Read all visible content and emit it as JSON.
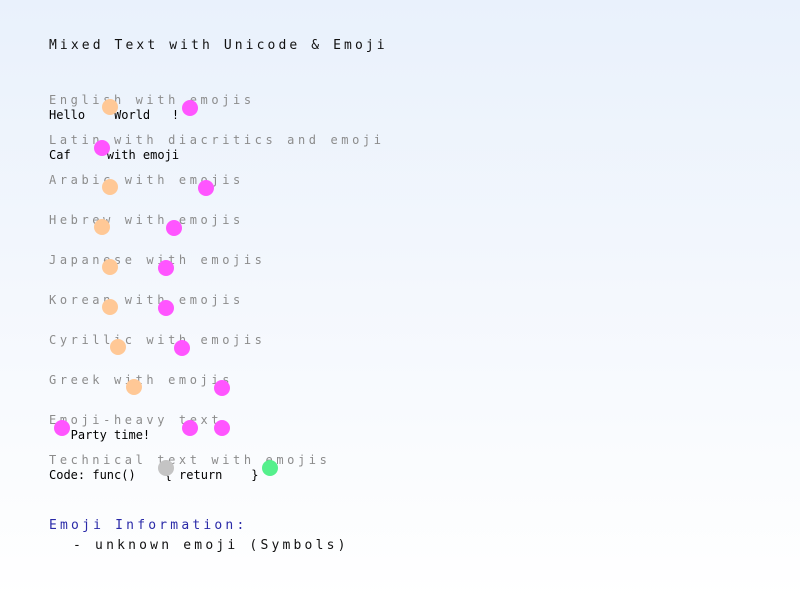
{
  "title": "Mixed Text with Unicode & Emoji",
  "sections": [
    {
      "label": "English with emojis",
      "sample": "Hello    World   !",
      "emoji_icons": [
        "face-emoji-icon",
        "party-emoji-icon"
      ]
    },
    {
      "label": "Latin with diacritics and emoji",
      "sample": "Caf     with emoji",
      "emoji_icons": [
        "coffee-emoji-icon"
      ]
    },
    {
      "label": "Arabic with emojis",
      "sample": "",
      "emoji_icons": [
        "face-emoji-icon",
        "heart-emoji-icon"
      ]
    },
    {
      "label": "Hebrew with emojis",
      "sample": "",
      "emoji_icons": [
        "face-emoji-icon",
        "heart-emoji-icon"
      ]
    },
    {
      "label": "Japanese with emojis",
      "sample": "",
      "emoji_icons": [
        "face-emoji-icon",
        "heart-emoji-icon"
      ]
    },
    {
      "label": "Korean with emojis",
      "sample": "",
      "emoji_icons": [
        "face-emoji-icon",
        "heart-emoji-icon"
      ]
    },
    {
      "label": "Cyrillic with emojis",
      "sample": "",
      "emoji_icons": [
        "face-emoji-icon",
        "heart-emoji-icon"
      ]
    },
    {
      "label": "Greek with emojis",
      "sample": "",
      "emoji_icons": [
        "face-emoji-icon",
        "heart-emoji-icon"
      ]
    },
    {
      "label": "Emoji-heavy text",
      "sample": "   Party time!",
      "emoji_icons": [
        "party-emoji-icon",
        "party-emoji-icon",
        "party-emoji-icon"
      ]
    },
    {
      "label": "Technical text with emojis",
      "sample": "Code: func()    { return    }",
      "emoji_icons": [
        "gear-emoji-icon",
        "check-emoji-icon"
      ]
    }
  ],
  "emoji_info": {
    "heading": "Emoji Information:",
    "items": [
      "- unknown emoji (Symbols)"
    ]
  },
  "colors": {
    "label_gray": "#8c8c8c",
    "info_heading_blue": "#2a2aa8",
    "emoji_peach": "#ffc896",
    "emoji_magenta": "#ff55ff",
    "emoji_gray": "#c4c4c4",
    "emoji_green": "#55f08c"
  }
}
